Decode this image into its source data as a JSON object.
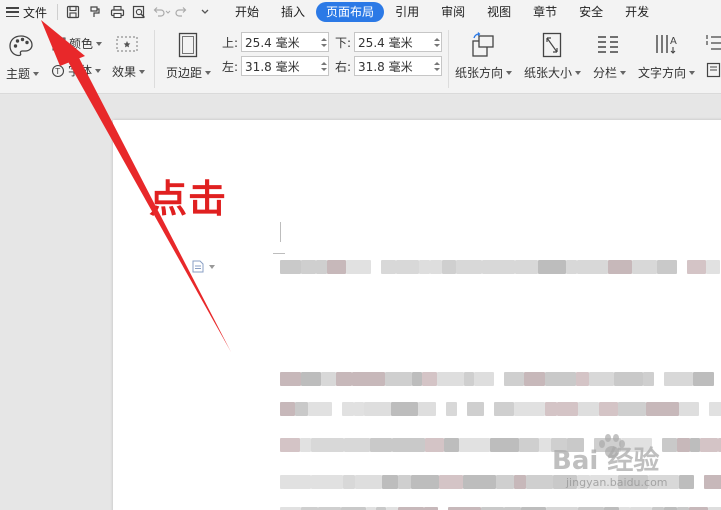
{
  "menubar": {
    "file_label": "文件",
    "tabs": [
      {
        "label": "开始",
        "active": false
      },
      {
        "label": "插入",
        "active": false
      },
      {
        "label": "页面布局",
        "active": true
      },
      {
        "label": "引用",
        "active": false
      },
      {
        "label": "审阅",
        "active": false
      },
      {
        "label": "视图",
        "active": false
      },
      {
        "label": "章节",
        "active": false
      },
      {
        "label": "安全",
        "active": false
      },
      {
        "label": "开发",
        "active": false
      }
    ],
    "quick_access_icons": [
      "save-icon",
      "format-painter-icon",
      "print-icon",
      "print-preview-icon",
      "undo-icon",
      "redo-icon",
      "customize-icon"
    ]
  },
  "ribbon": {
    "theme_label": "主题",
    "color_label": "颜色",
    "font_label": "字体",
    "effect_label": "效果",
    "margins_label": "页边距",
    "top_label": "上:",
    "top_value": "25.4 毫米",
    "bottom_label": "下:",
    "bottom_value": "25.4 毫米",
    "left_label": "左:",
    "left_value": "31.8 毫米",
    "right_label": "右:",
    "right_value": "31.8 毫米",
    "orientation_label": "纸张方向",
    "size_label": "纸张大小",
    "columns_label": "分栏",
    "text_direction_label": "文字方向"
  },
  "annotation": {
    "text": "点击",
    "color": "#e02020"
  },
  "watermark": {
    "main": "Bai 经验",
    "sub": "jingyan.baidu.com"
  },
  "colors": {
    "accent": "#2b79e6",
    "annotation": "#e02020"
  }
}
